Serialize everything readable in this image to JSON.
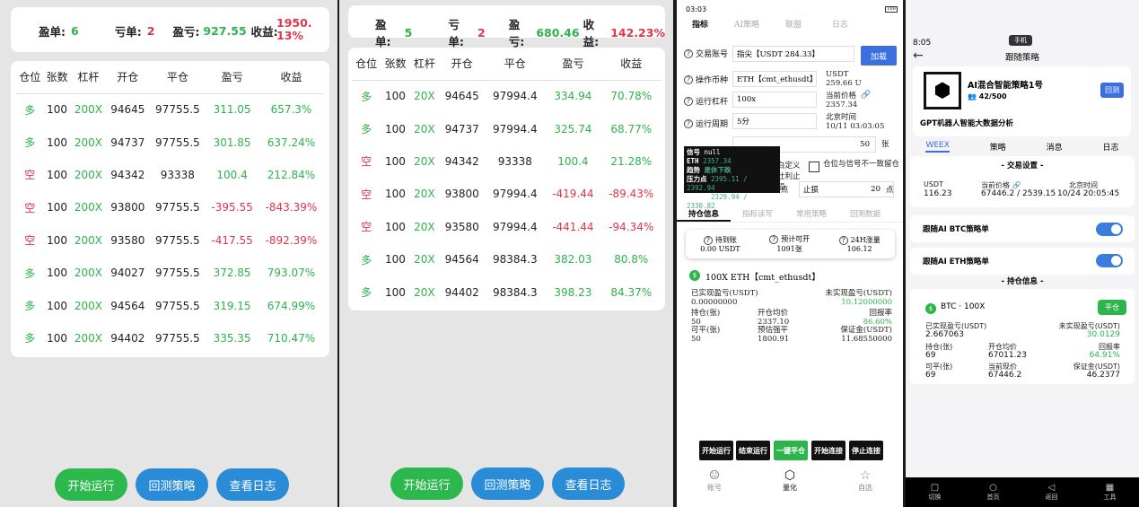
{
  "p1": {
    "summary": {
      "win_label": "盈单:",
      "win": "6",
      "loss_label": "亏单:",
      "loss": "2",
      "pnl_label": "盈亏:",
      "pnl": "927.55",
      "ret_label": "收益:",
      "ret": "1950.13%"
    },
    "headers": [
      "仓位",
      "张数",
      "杠杆",
      "开仓",
      "平仓",
      "盈亏",
      "收益"
    ],
    "rows": [
      [
        "多",
        "100",
        "200X",
        "94645",
        "97755.5",
        "311.05",
        "657.3%"
      ],
      [
        "多",
        "100",
        "200X",
        "94737",
        "97755.5",
        "301.85",
        "637.24%"
      ],
      [
        "空",
        "100",
        "200X",
        "94342",
        "93338",
        "100.4",
        "212.84%"
      ],
      [
        "空",
        "100",
        "200X",
        "93800",
        "97755.5",
        "-395.55",
        "-843.39%"
      ],
      [
        "空",
        "100",
        "200X",
        "93580",
        "97755.5",
        "-417.55",
        "-892.39%"
      ],
      [
        "多",
        "100",
        "200X",
        "94027",
        "97755.5",
        "372.85",
        "793.07%"
      ],
      [
        "多",
        "100",
        "200X",
        "94564",
        "97755.5",
        "319.15",
        "674.99%"
      ],
      [
        "多",
        "100",
        "200X",
        "94402",
        "97755.5",
        "335.35",
        "710.47%"
      ]
    ],
    "buttons": [
      "开始运行",
      "回测策略",
      "查看日志"
    ]
  },
  "p2": {
    "summary": {
      "win_label": "盈单:",
      "win": "5",
      "loss_label": "亏单:",
      "loss": "2",
      "pnl_label": "盈亏:",
      "pnl": "680.46",
      "ret_label": "收益:",
      "ret": "142.23%"
    },
    "headers": [
      "仓位",
      "张数",
      "杠杆",
      "开仓",
      "平仓",
      "盈亏",
      "收益"
    ],
    "rows": [
      [
        "多",
        "100",
        "20X",
        "94645",
        "97994.4",
        "334.94",
        "70.78%"
      ],
      [
        "多",
        "100",
        "20X",
        "94737",
        "97994.4",
        "325.74",
        "68.77%"
      ],
      [
        "空",
        "100",
        "20X",
        "94342",
        "93338",
        "100.4",
        "21.28%"
      ],
      [
        "空",
        "100",
        "20X",
        "93800",
        "97994.4",
        "-419.44",
        "-89.43%"
      ],
      [
        "空",
        "100",
        "20X",
        "93580",
        "97994.4",
        "-441.44",
        "-94.34%"
      ],
      [
        "多",
        "100",
        "20X",
        "94564",
        "98384.3",
        "382.03",
        "80.8%"
      ],
      [
        "多",
        "100",
        "20X",
        "94402",
        "98384.3",
        "398.23",
        "84.37%"
      ]
    ],
    "buttons": [
      "开始运行",
      "回测策略",
      "查看日志"
    ]
  },
  "p3": {
    "time": "03:03",
    "battery": "100",
    "tabs": [
      "指标",
      "AI策略",
      "联盟",
      "日志"
    ],
    "account_label": "交易账号",
    "account_value": "指尖【USDT 284.33】",
    "load_btn": "加载",
    "pair_label": "操作币种",
    "pair_value": "ETH【cmt_ethusdt】",
    "usdt_label": "USDT",
    "usdt_value": "259.66 U",
    "lev_label": "运行杠杆",
    "lev_value": "100x",
    "price_label": "当前价格",
    "price_value": "2357.34",
    "period_label": "运行周期",
    "period_value": "5分",
    "bj_label": "北京时间",
    "bj_value": "10/11 03:03:05",
    "qty_suffix": "张",
    "qty_value": "50",
    "tooltip": {
      "l1k": "信号",
      "l1v": "null",
      "l2k": "ETH",
      "l2v": "2357.34",
      "l3k": "趋势",
      "l3v": "是休下跌",
      "l4k": "压力点",
      "l4v": "2395.11 / 2392.94",
      "l5k": "支撑点",
      "l5v": "2329.94 / 2330.82"
    },
    "fragment": "白定义仕利止损",
    "check_label": "仓位与信号不一致留仓",
    "stop_label": "止损",
    "stop_value": "20",
    "stop_unit": "点",
    "tp_unit": "点",
    "subtabs": [
      "持仓信息",
      "指标读写",
      "常用策略",
      "回测数据"
    ],
    "stats": [
      {
        "label": "待到账",
        "value": "0.00 USDT"
      },
      {
        "label": "预计可开",
        "value": "1091张"
      },
      {
        "label": "24H涨量",
        "value": "106.12"
      }
    ],
    "pos_title": "100X ETH【cmt_ethusdt】",
    "realized_label": "已实现盈亏(USDT)",
    "realized": "0.00000000",
    "unreal_label": "未实现盈亏(USDT)",
    "unreal": "10.12000000",
    "hold_label": "持仓(张)",
    "hold": "50",
    "avg_label": "开仓均价",
    "avg": "2337.10",
    "roe_label": "回报率",
    "roe": "86.60%",
    "avail_label": "可平(张)",
    "avail": "50",
    "est_label": "预估强平",
    "est": "1800.91",
    "margin_label": "保证金(USDT)",
    "margin": "11.68550000",
    "actions": [
      "开始运行",
      "结束运行",
      "一键平仓",
      "开始连接",
      "停止连接"
    ],
    "nav": [
      "账号",
      "量化",
      "自选"
    ]
  },
  "p4": {
    "time": "8:05",
    "chip": "手机",
    "title": "跟随策略",
    "strategy_name": "AI混合智能策略1号",
    "followers": "42/500",
    "backtest_btn": "回测",
    "desc": "GPT机器人智能大数据分析",
    "tabs": [
      "WEEX",
      "策略",
      "消息",
      "日志"
    ],
    "settings_title": "- 交易设置 -",
    "usdt_label": "USDT",
    "usdt_value": "116.23",
    "cur_price_label": "当前价格",
    "cur_price_value": "67446.2 / 2539.15",
    "bj_label": "北京时间",
    "bj_value": "10/24 20:05:45",
    "follow_btc": "跟随AI BTC策略单",
    "follow_eth": "跟随AI ETH策略单",
    "hold_title": "- 持仓信息 -",
    "pos_name": "BTC · 100X",
    "close_btn": "平仓",
    "realized_label": "已实现盈亏(USDT)",
    "realized": "2.667063",
    "unreal_label": "未实现盈亏(USDT)",
    "unreal": "30.0129",
    "hold_label": "持仓(张)",
    "hold": "69",
    "avg_label": "开仓均价",
    "avg": "67011.23",
    "roe_label": "回报率",
    "roe": "64.91%",
    "avail_label": "可平(张)",
    "avail": "69",
    "cur_label": "当前现价",
    "cur": "67446.2",
    "margin_label": "保证金(USDT)",
    "margin": "46.2377",
    "nav": [
      "切换",
      "首页",
      "返回",
      "工具"
    ]
  }
}
